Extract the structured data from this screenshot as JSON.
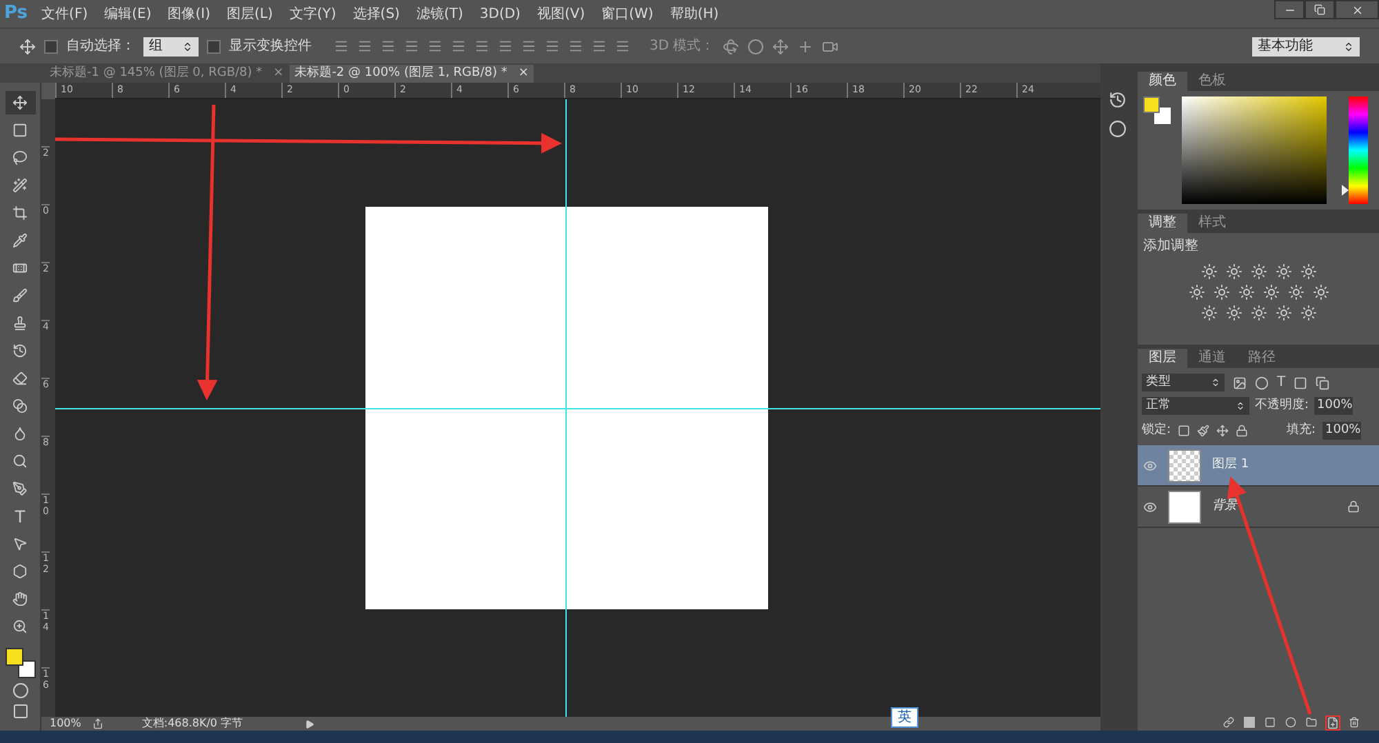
{
  "menu_bar": {
    "logo": "Ps",
    "items": [
      "文件(F)",
      "编辑(E)",
      "图像(I)",
      "图层(L)",
      "文字(Y)",
      "选择(S)",
      "滤镜(T)",
      "3D(D)",
      "视图(V)",
      "窗口(W)",
      "帮助(H)"
    ]
  },
  "options_bar": {
    "auto_select": {
      "label": "自动选择：",
      "checked": false,
      "value": "组"
    },
    "show_transform": {
      "label": "显示变换控件",
      "checked": false
    },
    "mode_label": "3D 模式：",
    "workspace": "基本功能"
  },
  "doc_tabs": [
    {
      "label": "未标题-1 @ 145% (图层 0, RGB/8) *",
      "close": "×",
      "selected": false
    },
    {
      "label": "未标题-2 @ 100% (图层 1, RGB/8) *",
      "close": "×",
      "selected": true
    }
  ],
  "rulers": {
    "horizontal": [
      "10",
      "8",
      "6",
      "4",
      "2",
      "0",
      "2",
      "4",
      "6",
      "8",
      "10",
      "12",
      "14",
      "16",
      "18",
      "20",
      "22",
      "24"
    ],
    "vertical": [
      "2",
      "0",
      "2",
      "4",
      "6",
      "8",
      "10",
      "12",
      "14",
      "16"
    ]
  },
  "tools": [
    {
      "kind": "move",
      "selected": true
    },
    {
      "kind": "marquee",
      "selected": false
    },
    {
      "kind": "lasso",
      "selected": false
    },
    {
      "kind": "wand",
      "selected": false
    },
    {
      "kind": "crop",
      "selected": false
    },
    {
      "kind": "eyedropper",
      "selected": false
    },
    {
      "kind": "heal",
      "selected": false
    },
    {
      "kind": "brush",
      "selected": false
    },
    {
      "kind": "stamp",
      "selected": false
    },
    {
      "kind": "history",
      "selected": false
    },
    {
      "kind": "eraser",
      "selected": false
    },
    {
      "kind": "gradient",
      "selected": false
    },
    {
      "kind": "blur",
      "selected": false
    },
    {
      "kind": "dodge",
      "selected": false
    },
    {
      "kind": "pen",
      "selected": false
    },
    {
      "kind": "type",
      "label": "T",
      "selected": false
    },
    {
      "kind": "path",
      "selected": false
    },
    {
      "kind": "shape",
      "selected": false
    },
    {
      "kind": "hand",
      "selected": false
    },
    {
      "kind": "zoom",
      "selected": false
    }
  ],
  "color_panel": {
    "hue_slider": {
      "level": 0.13
    },
    "tabs": [
      {
        "label": "颜色",
        "selected": true
      },
      {
        "label": "色板",
        "selected": false
      }
    ]
  },
  "adjustments_panel": {
    "tabs": [
      {
        "label": "调整",
        "selected": true
      },
      {
        "label": "样式",
        "selected": false
      }
    ],
    "heading": "添加调整"
  },
  "layers_panel": {
    "tabs": [
      {
        "label": "图层",
        "selected": true
      },
      {
        "label": "通道",
        "selected": false
      },
      {
        "label": "路径",
        "selected": false
      }
    ],
    "filter": "类型",
    "type_icon": "T",
    "blend_mode": "正常",
    "opacity_label": "不透明度:",
    "opacity": "100%",
    "lock_label": "锁定:",
    "fill_label": "填充:",
    "fill": "100%",
    "layers": [
      {
        "name": "图层 1",
        "kind": "transparent",
        "selected": true,
        "visible": true,
        "locked": false
      },
      {
        "name": "背景",
        "kind": "background",
        "selected": false,
        "visible": true,
        "locked": true
      }
    ]
  },
  "status_bar": {
    "zoom": "100%",
    "document": "文档:468.8K/0 字节"
  },
  "ime_bar": {
    "label": "英"
  }
}
